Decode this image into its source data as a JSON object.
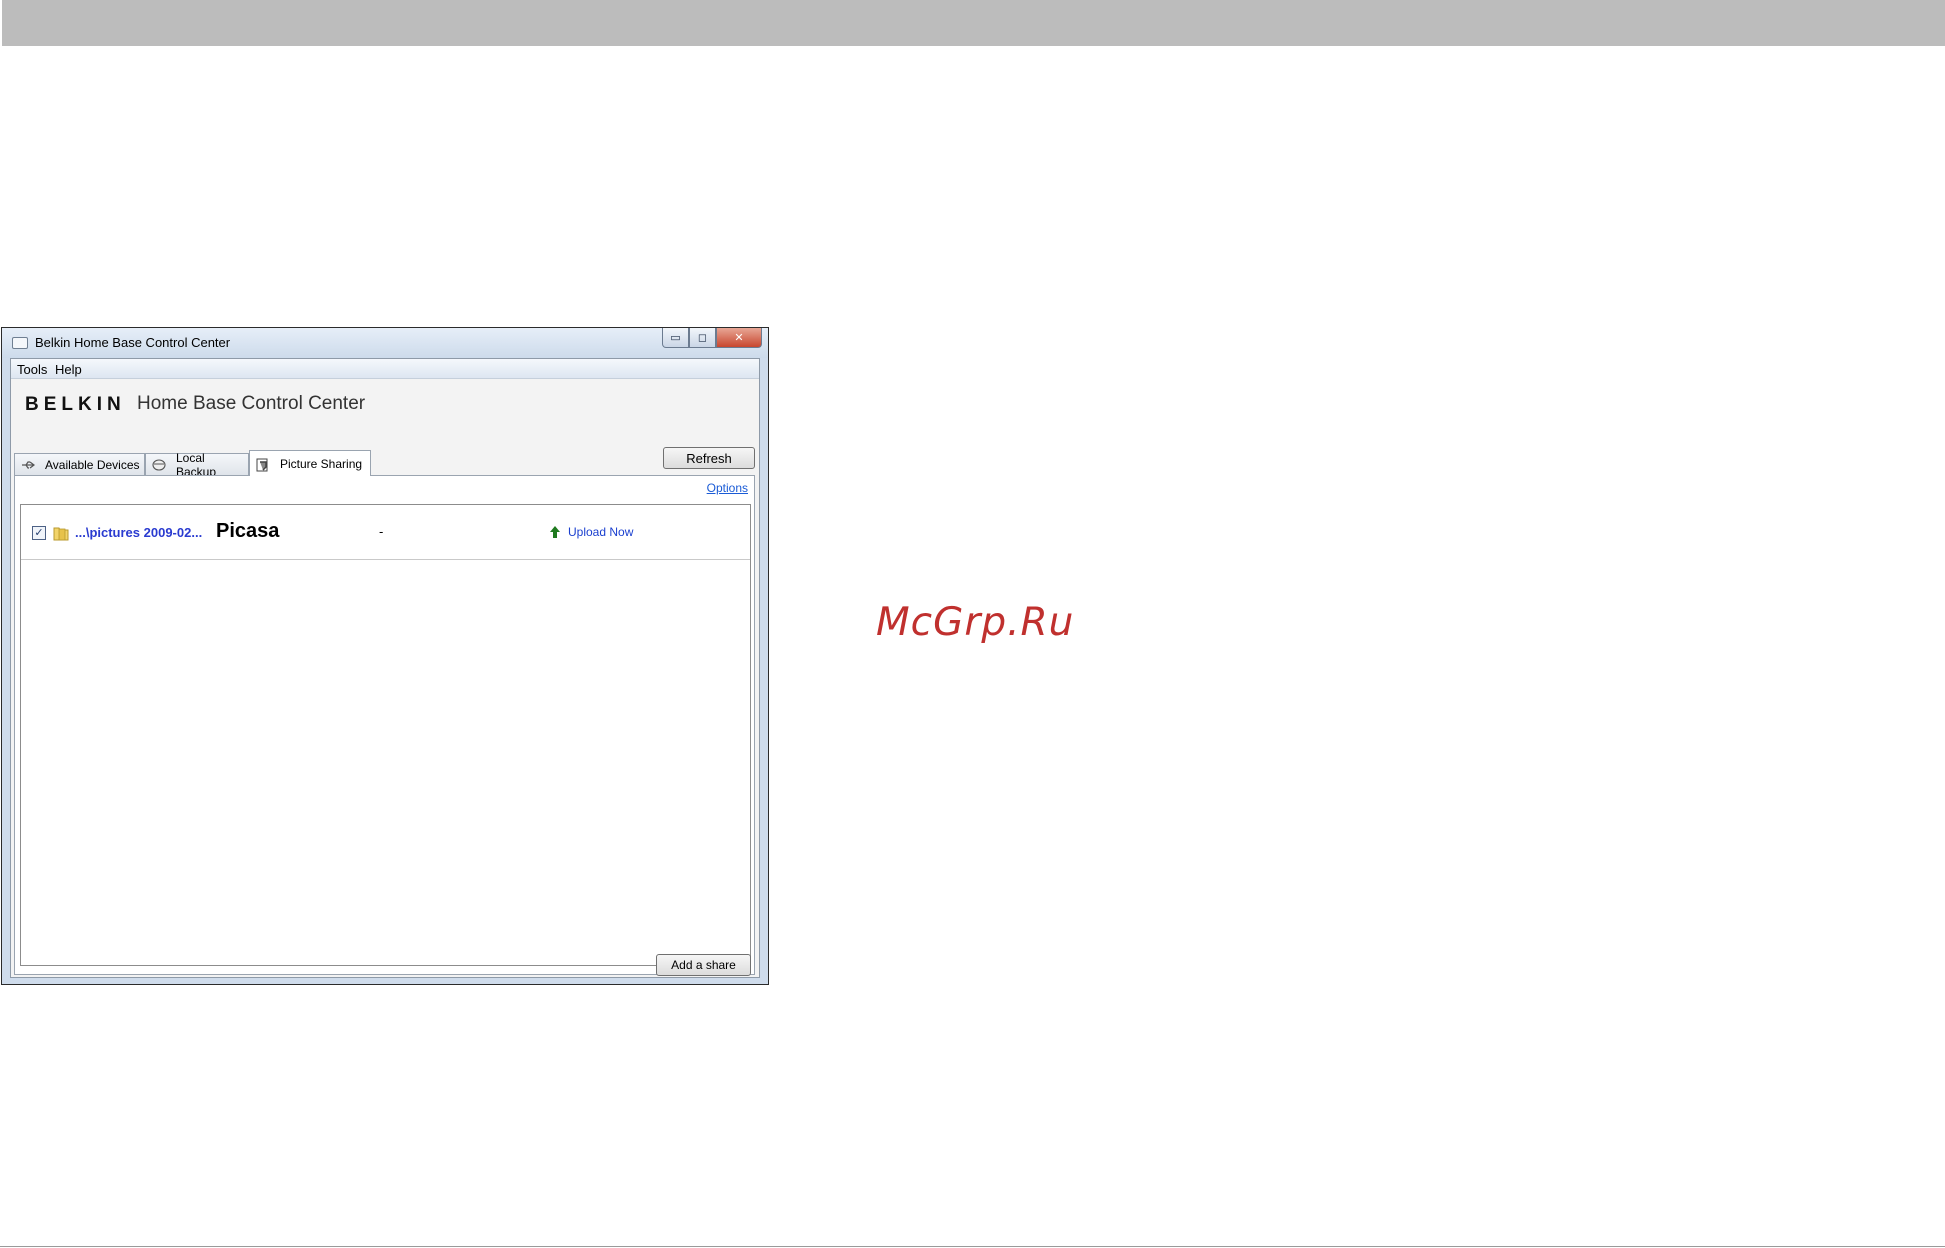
{
  "window": {
    "title": "Belkin Home Base Control Center",
    "controls": {
      "minimize": "▭",
      "maximize": "◻",
      "close": "✕"
    }
  },
  "menu": {
    "tools": "Tools",
    "help": "Help"
  },
  "branding": {
    "logo": "BELKIN",
    "subtitle": "Home Base Control Center"
  },
  "tabs": [
    {
      "label": "Available Devices",
      "icon": "usb-icon"
    },
    {
      "label": "Local Backup",
      "icon": "disk-icon"
    },
    {
      "label": "Picture Sharing",
      "icon": "picture-icon",
      "active": true
    }
  ],
  "toolbar": {
    "refresh_label": "Refresh",
    "options_label": "Options"
  },
  "shares": [
    {
      "checked": true,
      "check_glyph": "✓",
      "path": "...\\pictures 2009-02...",
      "service": "Picasa",
      "status": "-",
      "action": "Upload Now"
    }
  ],
  "footer": {
    "add_share_label": "Add a share"
  },
  "watermark": "McGrp.Ru",
  "colors": {
    "link": "#1a5bd6",
    "path": "#2a3bd0",
    "upload_arrow": "#1f7a1f",
    "watermark": "#c0302e",
    "header_bar": "#bcbcbc"
  }
}
